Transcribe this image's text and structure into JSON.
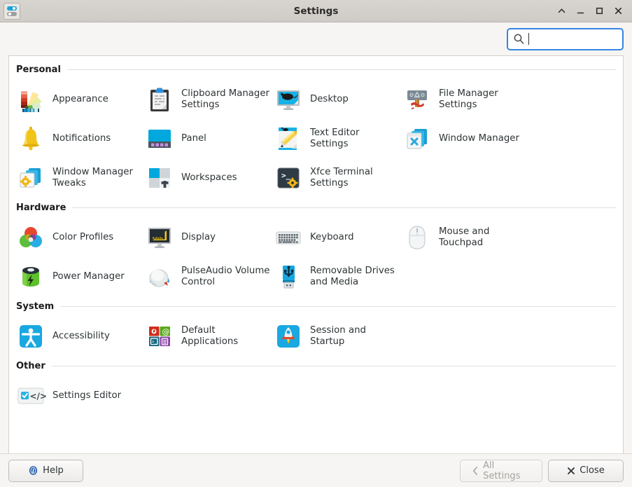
{
  "window": {
    "title": "Settings",
    "icon": "settings-sliders-icon",
    "controls": [
      {
        "name": "shade-button",
        "glyph": "shade"
      },
      {
        "name": "minimize-button",
        "glyph": "minimize"
      },
      {
        "name": "maximize-button",
        "glyph": "maximize"
      },
      {
        "name": "close-button",
        "glyph": "close"
      }
    ]
  },
  "search": {
    "icon": "search-icon",
    "value": "",
    "placeholder": ""
  },
  "sections": [
    {
      "title": "Personal",
      "items": [
        {
          "label": "Appearance",
          "icon": "appearance-icon"
        },
        {
          "label": "Clipboard Manager Settings",
          "icon": "clipboard-manager-icon"
        },
        {
          "label": "Desktop",
          "icon": "desktop-icon"
        },
        {
          "label": "File Manager Settings",
          "icon": "file-manager-icon"
        },
        {
          "label": "Notifications",
          "icon": "notifications-bell-icon"
        },
        {
          "label": "Panel",
          "icon": "panel-icon"
        },
        {
          "label": "Text Editor Settings",
          "icon": "text-editor-icon"
        },
        {
          "label": "Window Manager",
          "icon": "window-manager-icon"
        },
        {
          "label": "Window Manager Tweaks",
          "icon": "window-manager-tweaks-icon"
        },
        {
          "label": "Workspaces",
          "icon": "workspaces-icon"
        },
        {
          "label": "Xfce Terminal Settings",
          "icon": "xfce-terminal-icon"
        }
      ]
    },
    {
      "title": "Hardware",
      "items": [
        {
          "label": "Color Profiles",
          "icon": "color-profiles-icon"
        },
        {
          "label": "Display",
          "icon": "display-icon"
        },
        {
          "label": "Keyboard",
          "icon": "keyboard-icon"
        },
        {
          "label": "Mouse and Touchpad",
          "icon": "mouse-icon"
        },
        {
          "label": "Power Manager",
          "icon": "power-manager-battery-icon"
        },
        {
          "label": "PulseAudio Volume Control",
          "icon": "pulseaudio-volume-icon"
        },
        {
          "label": "Removable Drives and Media",
          "icon": "removable-drives-usb-icon"
        }
      ]
    },
    {
      "title": "System",
      "items": [
        {
          "label": "Accessibility",
          "icon": "accessibility-icon"
        },
        {
          "label": "Default Applications",
          "icon": "default-applications-icon"
        },
        {
          "label": "Session and Startup",
          "icon": "session-startup-rocket-icon"
        }
      ]
    },
    {
      "title": "Other",
      "items": [
        {
          "label": "Settings Editor",
          "icon": "settings-editor-icon"
        }
      ]
    }
  ],
  "actions": {
    "help_label": "Help",
    "help_icon": "help-circle-icon",
    "all_settings_label": "All Settings",
    "all_settings_icon": "chevron-left-icon",
    "close_label": "Close",
    "close_icon": "close-x-icon"
  },
  "colors": {
    "accent": "#3584e4",
    "xfce_cyan": "#02a0d8",
    "titlebar": "#d4d0cc",
    "panel_bg": "#ffffff",
    "window_bg": "#f6f5f4"
  }
}
